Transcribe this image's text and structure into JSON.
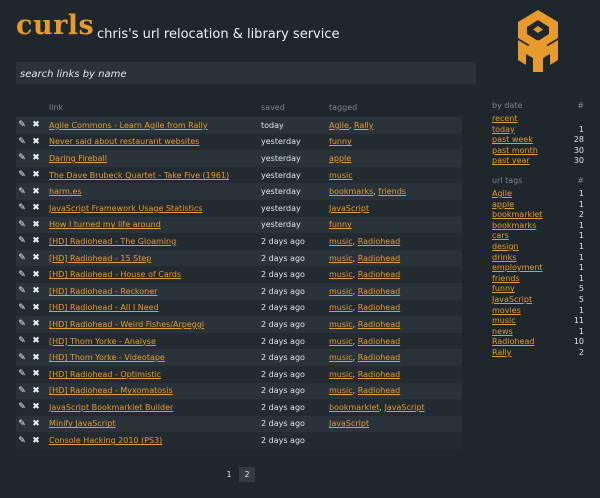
{
  "header": {
    "logo": "curls",
    "tagline": "chris's url relocation & library service"
  },
  "search": {
    "placeholder": "search links by name"
  },
  "table": {
    "headers": {
      "link": "link",
      "saved": "saved",
      "tagged": "tagged"
    },
    "rows": [
      {
        "title": "Agile Commons - Learn Agile from Rally",
        "saved": "today",
        "tags": [
          "Agile",
          "Rally"
        ]
      },
      {
        "title": "Never said about restaurant websites",
        "saved": "yesterday",
        "tags": [
          "funny"
        ]
      },
      {
        "title": "Daring Fireball",
        "saved": "yesterday",
        "tags": [
          "apple"
        ]
      },
      {
        "title": "The Dave Brubeck Quartet - Take Five (1961)",
        "saved": "yesterday",
        "tags": [
          "music"
        ]
      },
      {
        "title": "harm.es",
        "saved": "yesterday",
        "tags": [
          "bookmarks",
          "friends"
        ]
      },
      {
        "title": "JavaScript Framework Usage Statistics",
        "saved": "yesterday",
        "tags": [
          "JavaScript"
        ]
      },
      {
        "title": "How I turned my life around",
        "saved": "yesterday",
        "tags": [
          "funny"
        ]
      },
      {
        "title": "[HD] Radiohead - The Gloaming",
        "saved": "2 days ago",
        "tags": [
          "music",
          "Radiohead"
        ]
      },
      {
        "title": "[HD] Radiohead - 15 Step",
        "saved": "2 days ago",
        "tags": [
          "music",
          "Radiohead"
        ]
      },
      {
        "title": "[HD] Radiohead - House of Cards",
        "saved": "2 days ago",
        "tags": [
          "music",
          "Radiohead"
        ]
      },
      {
        "title": "[HD] Radiohead - Reckoner",
        "saved": "2 days ago",
        "tags": [
          "music",
          "Radiohead"
        ]
      },
      {
        "title": "[HD] Radiohead - All I Need",
        "saved": "2 days ago",
        "tags": [
          "music",
          "Radiohead"
        ]
      },
      {
        "title": "[HD] Radiohead - Weird Fishes/Arpeggi",
        "saved": "2 days ago",
        "tags": [
          "music",
          "Radiohead"
        ]
      },
      {
        "title": "[HD] Thom Yorke - Analyse",
        "saved": "2 days ago",
        "tags": [
          "music",
          "Radiohead"
        ]
      },
      {
        "title": "[HD] Thom Yorke - Videotape",
        "saved": "2 days ago",
        "tags": [
          "music",
          "Radiohead"
        ]
      },
      {
        "title": "[HD] Radiohead - Optimistic",
        "saved": "2 days ago",
        "tags": [
          "music",
          "Radiohead"
        ]
      },
      {
        "title": "[HD] Radiohead - Myxomatosis",
        "saved": "2 days ago",
        "tags": [
          "music",
          "Radiohead"
        ]
      },
      {
        "title": "JavaScript Bookmarklet Builder",
        "saved": "2 days ago",
        "tags": [
          "bookmarklet",
          "JavaScript"
        ]
      },
      {
        "title": "Minify JavaScript",
        "saved": "2 days ago",
        "tags": [
          "JavaScript"
        ]
      },
      {
        "title": "Console Hacking 2010 (PS3)",
        "saved": "2 days ago",
        "tags": []
      }
    ]
  },
  "pagination": {
    "pages": [
      "1",
      "2"
    ],
    "current": "2"
  },
  "sidebar": {
    "by_date": {
      "title": "by date",
      "count_label": "#",
      "items": [
        {
          "label": "recent",
          "count": ""
        },
        {
          "label": "today",
          "count": "1"
        },
        {
          "label": "past week",
          "count": "28"
        },
        {
          "label": "past month",
          "count": "30"
        },
        {
          "label": "past year",
          "count": "30"
        }
      ]
    },
    "url_tags": {
      "title": "url tags",
      "count_label": "#",
      "items": [
        {
          "label": "Agile",
          "count": "1"
        },
        {
          "label": "apple",
          "count": "1"
        },
        {
          "label": "bookmarklet",
          "count": "2"
        },
        {
          "label": "bookmarks",
          "count": "1"
        },
        {
          "label": "cars",
          "count": "1"
        },
        {
          "label": "design",
          "count": "1"
        },
        {
          "label": "drinks",
          "count": "1"
        },
        {
          "label": "employment",
          "count": "1"
        },
        {
          "label": "friends",
          "count": "1"
        },
        {
          "label": "funny",
          "count": "5"
        },
        {
          "label": "JavaScript",
          "count": "5"
        },
        {
          "label": "movies",
          "count": "1"
        },
        {
          "label": "music",
          "count": "11"
        },
        {
          "label": "news",
          "count": "1"
        },
        {
          "label": "Radiohead",
          "count": "10"
        },
        {
          "label": "Rally",
          "count": "2"
        }
      ]
    }
  },
  "icons": {
    "edit": "pencil-icon",
    "delete": "delete-x-icon"
  },
  "colors": {
    "background": "#1f272d",
    "accent": "#e79b2c",
    "row_odd": "#2a323a",
    "row_even": "#232b31",
    "muted": "#7c868e"
  }
}
